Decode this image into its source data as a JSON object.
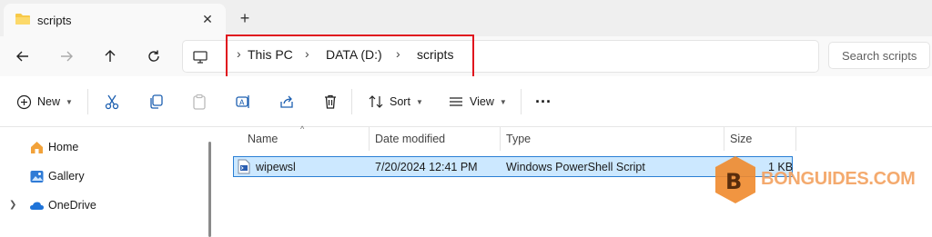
{
  "window": {
    "tab_title": "scripts",
    "tab_close": "✕",
    "new_tab": "+"
  },
  "nav": {
    "back": "back-arrow",
    "forward": "forward-arrow",
    "up": "up-arrow",
    "refresh": "refresh"
  },
  "breadcrumb": {
    "items": [
      "This PC",
      "DATA (D:)",
      "scripts"
    ],
    "separator": "›",
    "highlight_color": "#e0141e"
  },
  "search": {
    "placeholder": "Search scripts"
  },
  "commands": {
    "new_label": "New",
    "sort_label": "Sort",
    "view_label": "View",
    "more_label": "···"
  },
  "sidebar": {
    "items": [
      {
        "label": "Home",
        "icon": "home-icon"
      },
      {
        "label": "Gallery",
        "icon": "gallery-icon"
      },
      {
        "label": "OneDrive",
        "icon": "cloud-icon"
      }
    ]
  },
  "table": {
    "columns": [
      "Name",
      "Date modified",
      "Type",
      "Size"
    ],
    "rows": [
      {
        "name": "wipewsl",
        "date": "7/20/2024 12:41 PM",
        "type": "Windows PowerShell Script",
        "size": "1 KB"
      }
    ]
  },
  "watermark": {
    "text": "BONGUIDES.COM",
    "letter": "B",
    "color": "#f08a2c"
  },
  "colors": {
    "selection_bg": "#cce8ff",
    "selection_border": "#2a7fd4",
    "accent": "#0067c0"
  }
}
